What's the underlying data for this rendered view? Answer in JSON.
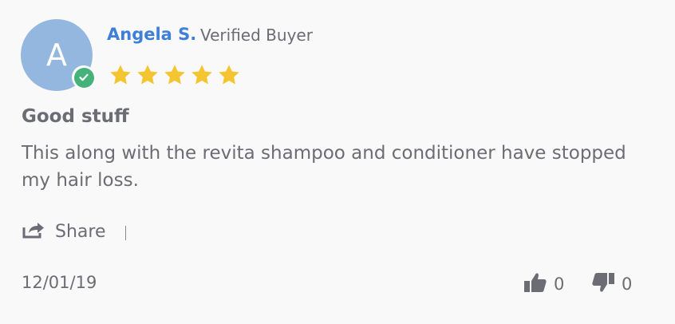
{
  "reviewer": {
    "initial": "A",
    "name": "Angela S.",
    "badge": "Verified Buyer",
    "avatar_color": "#93b7de",
    "verified_icon": "check-circle-icon"
  },
  "rating": {
    "value": 5,
    "max": 5,
    "star_color": "#f5c431"
  },
  "review": {
    "title": "Good stuff",
    "body": "This along with the revita shampoo and conditioner have stopped my hair loss."
  },
  "actions": {
    "share_label": "Share",
    "share_icon": "share-icon"
  },
  "footer": {
    "date": "12/01/19",
    "helpful_count": "0",
    "unhelpful_count": "0",
    "thumbs_up_icon": "thumbs-up-icon",
    "thumbs_down_icon": "thumbs-down-icon"
  }
}
